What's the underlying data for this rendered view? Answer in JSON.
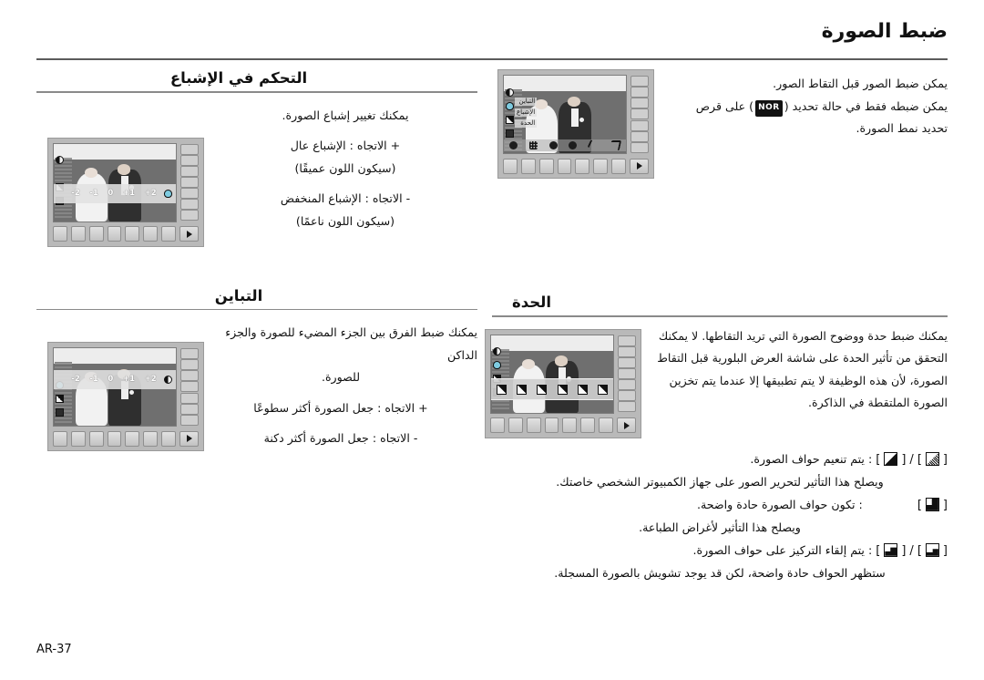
{
  "page": {
    "title": "ضبط الصورة",
    "footer": "AR-37"
  },
  "intro": {
    "line1": "يمكن ضبط الصور قبل التقاط الصور.",
    "line2_pre": "يمكن ضبطه فقط في حالة تحديد (",
    "badge": "NOR",
    "line2_post": ") على قرص",
    "line3": "تحديد نمط الصورة."
  },
  "saturation": {
    "heading": "التحكم في الإشباع",
    "desc": "يمكنك تغيير إشباع الصورة.",
    "plus_label": "+ الاتجاه : الإشباع عال",
    "plus_note": "(سيكون اللون عميقًا)",
    "minus_label": "- الاتجاه : الإشباع المنخفض",
    "minus_note": "(سيكون اللون ناعمًا)"
  },
  "contrast": {
    "heading": "التباين",
    "desc_line1": "يمكنك ضبط الفرق بين الجزء المضيء للصورة والجزء الداكن",
    "desc_line2": "للصورة.",
    "plus_label": "+ الاتجاه : جعل الصورة أكثر سطوعًا",
    "minus_label": "- الاتجاه : جعل الصورة أكثر دكنة"
  },
  "sharpness": {
    "heading": "الحدة",
    "desc_line1": "يمكنك ضبط حدة ووضوح الصورة التي تريد التقاطها. لا يمكنك",
    "desc_line2": "التحقق من تأثير الحدة على شاشة العرض البلورية قبل التقاط",
    "desc_line3": "الصورة، لأن هذه الوظيفة لا يتم تطبيقها إلا عندما يتم تخزين",
    "desc_line4": "الصورة الملتقطة في الذاكرة."
  },
  "legend": {
    "bracket_open": "[",
    "bracket_close": "]",
    "slash": "/",
    "rows": [
      {
        "icons": [
          "sharpness-soft-dither-icon",
          "sharpness-soft-solid-icon"
        ],
        "text": ": يتم تنعيم حواف الصورة.",
        "note": "ويصلح هذا التأثير لتحرير الصور على جهاز الكمبيوتر الشخصي خاصتك."
      },
      {
        "icons": [
          "sharpness-normal-step-icon"
        ],
        "text": ": تكون حواف الصورة حادة واضحة.",
        "note": "ويصلح هذا التأثير لأغراض الطباعة."
      },
      {
        "icons": [
          "sharpness-vivid-step-icon",
          "sharpness-vivid-step2-icon"
        ],
        "text": ": يتم إلقاء التركيز على حواف الصورة.",
        "note": "ستظهر الحواف حادة واضحة، لكن قد يوجد تشويش بالصورة المسجلة."
      }
    ]
  },
  "lcd": {
    "scale": [
      "-2",
      "-1",
      "0",
      "+1",
      "+2"
    ],
    "menu_items": [
      "التباين",
      "الإشباع",
      "الحدة"
    ]
  }
}
